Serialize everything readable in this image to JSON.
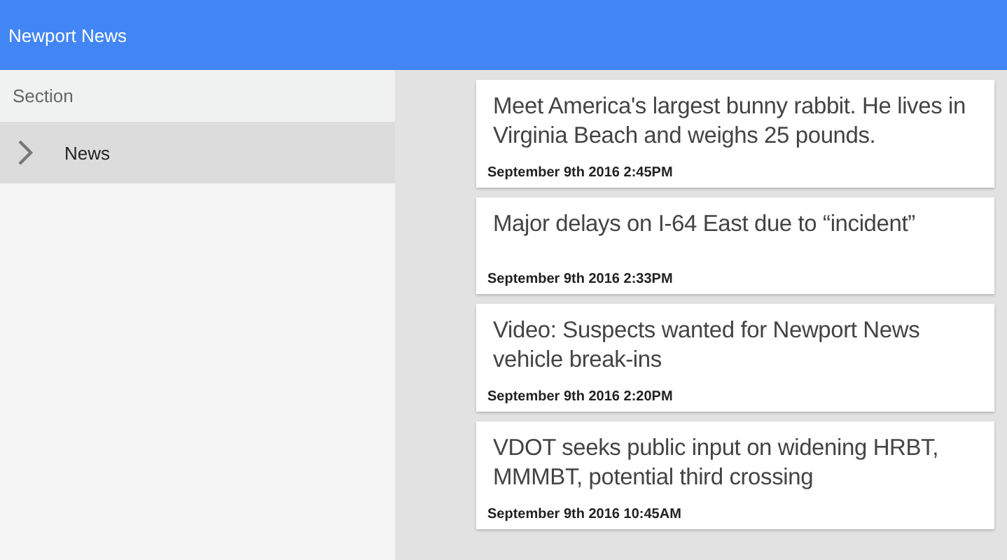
{
  "app_bar": {
    "title": "Newport News"
  },
  "sidebar": {
    "header": "Section",
    "items": [
      {
        "label": "News",
        "selected": true
      }
    ]
  },
  "articles": [
    {
      "title": "Meet America's largest bunny rabbit. He lives in Virginia Beach and weighs 25 pounds.",
      "date": "September 9th 2016 2:45PM"
    },
    {
      "title": "Major delays on I-64 East due to “incident”",
      "date": "September 9th 2016 2:33PM"
    },
    {
      "title": "Video: Suspects wanted for Newport News vehicle break-ins",
      "date": "September 9th 2016 2:20PM"
    },
    {
      "title": "VDOT seeks public input on widening HRBT, MMMBT, potential third crossing",
      "date": "September 9th 2016 10:45AM"
    }
  ]
}
